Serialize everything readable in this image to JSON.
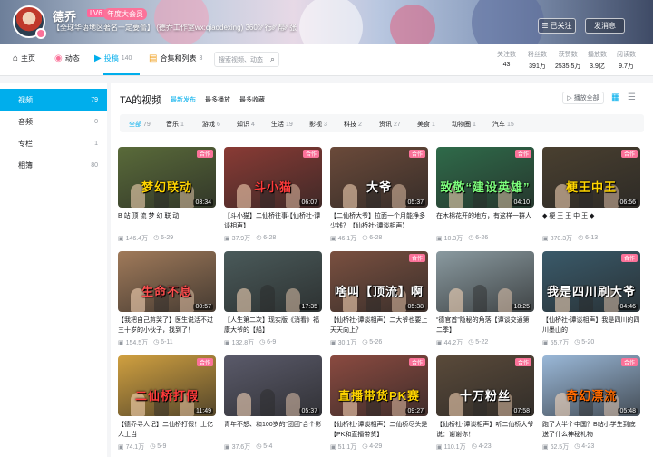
{
  "profile": {
    "name": "德乔",
    "level": "LV6",
    "vip": "年度大会员",
    "signature": "【全球华语地区著名一定要蕾】 (德乔工作室wx:qiaodexing) 360°∕∕ 行∕∕∕ 帮∕∕ 张"
  },
  "header_buttons": {
    "follow": "已关注",
    "message": "发消息"
  },
  "nav": {
    "tabs": [
      {
        "label": "主页",
        "count": "",
        "icon": "home-icon"
      },
      {
        "label": "动态",
        "count": "",
        "icon": "dynamic-icon"
      },
      {
        "label": "投稿",
        "count": "140",
        "icon": "upload-icon"
      },
      {
        "label": "合集和列表",
        "count": "3",
        "icon": "collection-icon"
      }
    ],
    "search_placeholder": "搜索视频、动态"
  },
  "stats": [
    {
      "label": "关注数",
      "value": "43"
    },
    {
      "label": "粉丝数",
      "value": "391万"
    },
    {
      "label": "获赞数",
      "value": "2535.5万"
    },
    {
      "label": "播放数",
      "value": "3.9亿"
    },
    {
      "label": "阅读数",
      "value": "9.7万"
    }
  ],
  "sidebar": {
    "items": [
      {
        "label": "视频",
        "count": "79"
      },
      {
        "label": "音频",
        "count": "0"
      },
      {
        "label": "专栏",
        "count": "1"
      },
      {
        "label": "相簿",
        "count": "80"
      }
    ]
  },
  "main": {
    "title": "TA的视频",
    "sort": [
      "最新发布",
      "最多播放",
      "最多收藏"
    ],
    "play_all": "播放全部",
    "tags": [
      {
        "label": "全部",
        "count": "79"
      },
      {
        "label": "音乐",
        "count": "1"
      },
      {
        "label": "游戏",
        "count": "6"
      },
      {
        "label": "知识",
        "count": "4"
      },
      {
        "label": "生活",
        "count": "19"
      },
      {
        "label": "影视",
        "count": "3"
      },
      {
        "label": "科技",
        "count": "2"
      },
      {
        "label": "资讯",
        "count": "27"
      },
      {
        "label": "美食",
        "count": "1"
      },
      {
        "label": "动物圈",
        "count": "1"
      },
      {
        "label": "汽车",
        "count": "15"
      }
    ]
  },
  "videos": [
    {
      "caption": "梦幻联动",
      "title": "B 站 顶 流 梦 幻 联 动",
      "duration": "03:34",
      "coop": "合作",
      "views": "146.4万",
      "date": "6-29",
      "bg": "#5a6b3a",
      "capcolor": "#ffd400"
    },
    {
      "caption": "斗小猫",
      "title": "【斗小猫】二仙桥往事·【仙桥社-谭谈相声】",
      "duration": "06:07",
      "coop": "合作",
      "views": "37.9万",
      "date": "6-28",
      "bg": "#8a3b35",
      "capcolor": "#ff3b3b"
    },
    {
      "caption": "大爷",
      "title": "【二仙桥大爷】拉面一个月能挣多少钱？【仙桥社-谭谈相声】",
      "duration": "05:37",
      "coop": "合作",
      "views": "46.1万",
      "date": "6-28",
      "bg": "#6b4a3a",
      "capcolor": "#ffffff"
    },
    {
      "caption": "致敬“建设英雄”",
      "title": "在木棉花开的地方，有这样一群人",
      "duration": "04:10",
      "coop": "合作",
      "views": "10.3万",
      "date": "6-26",
      "bg": "#2f6b4a",
      "capcolor": "#7dff7d"
    },
    {
      "caption": "梗王中王",
      "title": "◆ 梗 王 王 中 王 ◆",
      "duration": "06:56",
      "coop": "合作",
      "views": "870.3万",
      "date": "6-13",
      "bg": "#4a4030",
      "capcolor": "#ffd400"
    },
    {
      "caption": "生命不息",
      "title": "【我把自己剪哭了】医生说活不过三十岁的小伙子，找到了！",
      "duration": "00:57",
      "coop": "",
      "views": "154.5万",
      "date": "6-11",
      "bg": "#a07a5a",
      "capcolor": "#ff4f4f"
    },
    {
      "caption": "",
      "title": "【人生第二次】现实版《消看》福康大爷的【船】",
      "duration": "17:35",
      "coop": "",
      "views": "132.8万",
      "date": "6-9",
      "bg": "#4a5a5a",
      "capcolor": "#ffffff"
    },
    {
      "caption": "啥叫【顶流】啊",
      "title": "【仙桥社-谭谈相声】二大爷也要上天天向上？",
      "duration": "05:38",
      "coop": "合作",
      "views": "30.1万",
      "date": "5-26",
      "bg": "#7a5040",
      "capcolor": "#ffffff"
    },
    {
      "caption": "",
      "title": "“德官首”隐秘的角落【谭谈交通第二季】",
      "duration": "18:25",
      "coop": "",
      "views": "44.2万",
      "date": "5-22",
      "bg": "#8a9aa0",
      "capcolor": "#ffffff"
    },
    {
      "caption": "我是四川刷大爷",
      "title": "【仙桥社-谭谈相声】我是四川的四川墨山的",
      "duration": "04:46",
      "coop": "合作",
      "views": "55.7万",
      "date": "5-20",
      "bg": "#3a5a6a",
      "capcolor": "#ffffff"
    },
    {
      "caption": "二仙桥打假",
      "title": "【德乔寻人记】二仙桥打假！上亿人上当",
      "duration": "11:49",
      "coop": "合作",
      "views": "74.1万",
      "date": "5-9",
      "bg": "#d0a040",
      "capcolor": "#ff3b3b"
    },
    {
      "caption": "",
      "title": "青年不怒、和100岁的“团团”合个影",
      "duration": "05:37",
      "coop": "",
      "views": "37.6万",
      "date": "5-4",
      "bg": "#5a5a6a",
      "capcolor": "#ffffff"
    },
    {
      "caption": "直播带货PK赛",
      "title": "【仙桥社-谭谈相声】二仙桥尽头是【PK和直播带货】",
      "duration": "09:27",
      "coop": "合作",
      "views": "51.1万",
      "date": "4-29",
      "bg": "#8a4a40",
      "capcolor": "#ffd400"
    },
    {
      "caption": "十万粉丝",
      "title": "【仙桥社-谭谈相声】听二仙桥大爷说：谢谢你！",
      "duration": "07:58",
      "coop": "合作",
      "views": "110.1万",
      "date": "4-23",
      "bg": "#5a4a3a",
      "capcolor": "#ffffff"
    },
    {
      "caption": "奇幻漂流",
      "title": "跑了大半个中国？B站小学生到底送了什么神秘礼物",
      "duration": "05:48",
      "coop": "合作",
      "views": "62.5万",
      "date": "4-23",
      "bg": "#9ab8d8",
      "capcolor": "#ff6a00"
    }
  ]
}
